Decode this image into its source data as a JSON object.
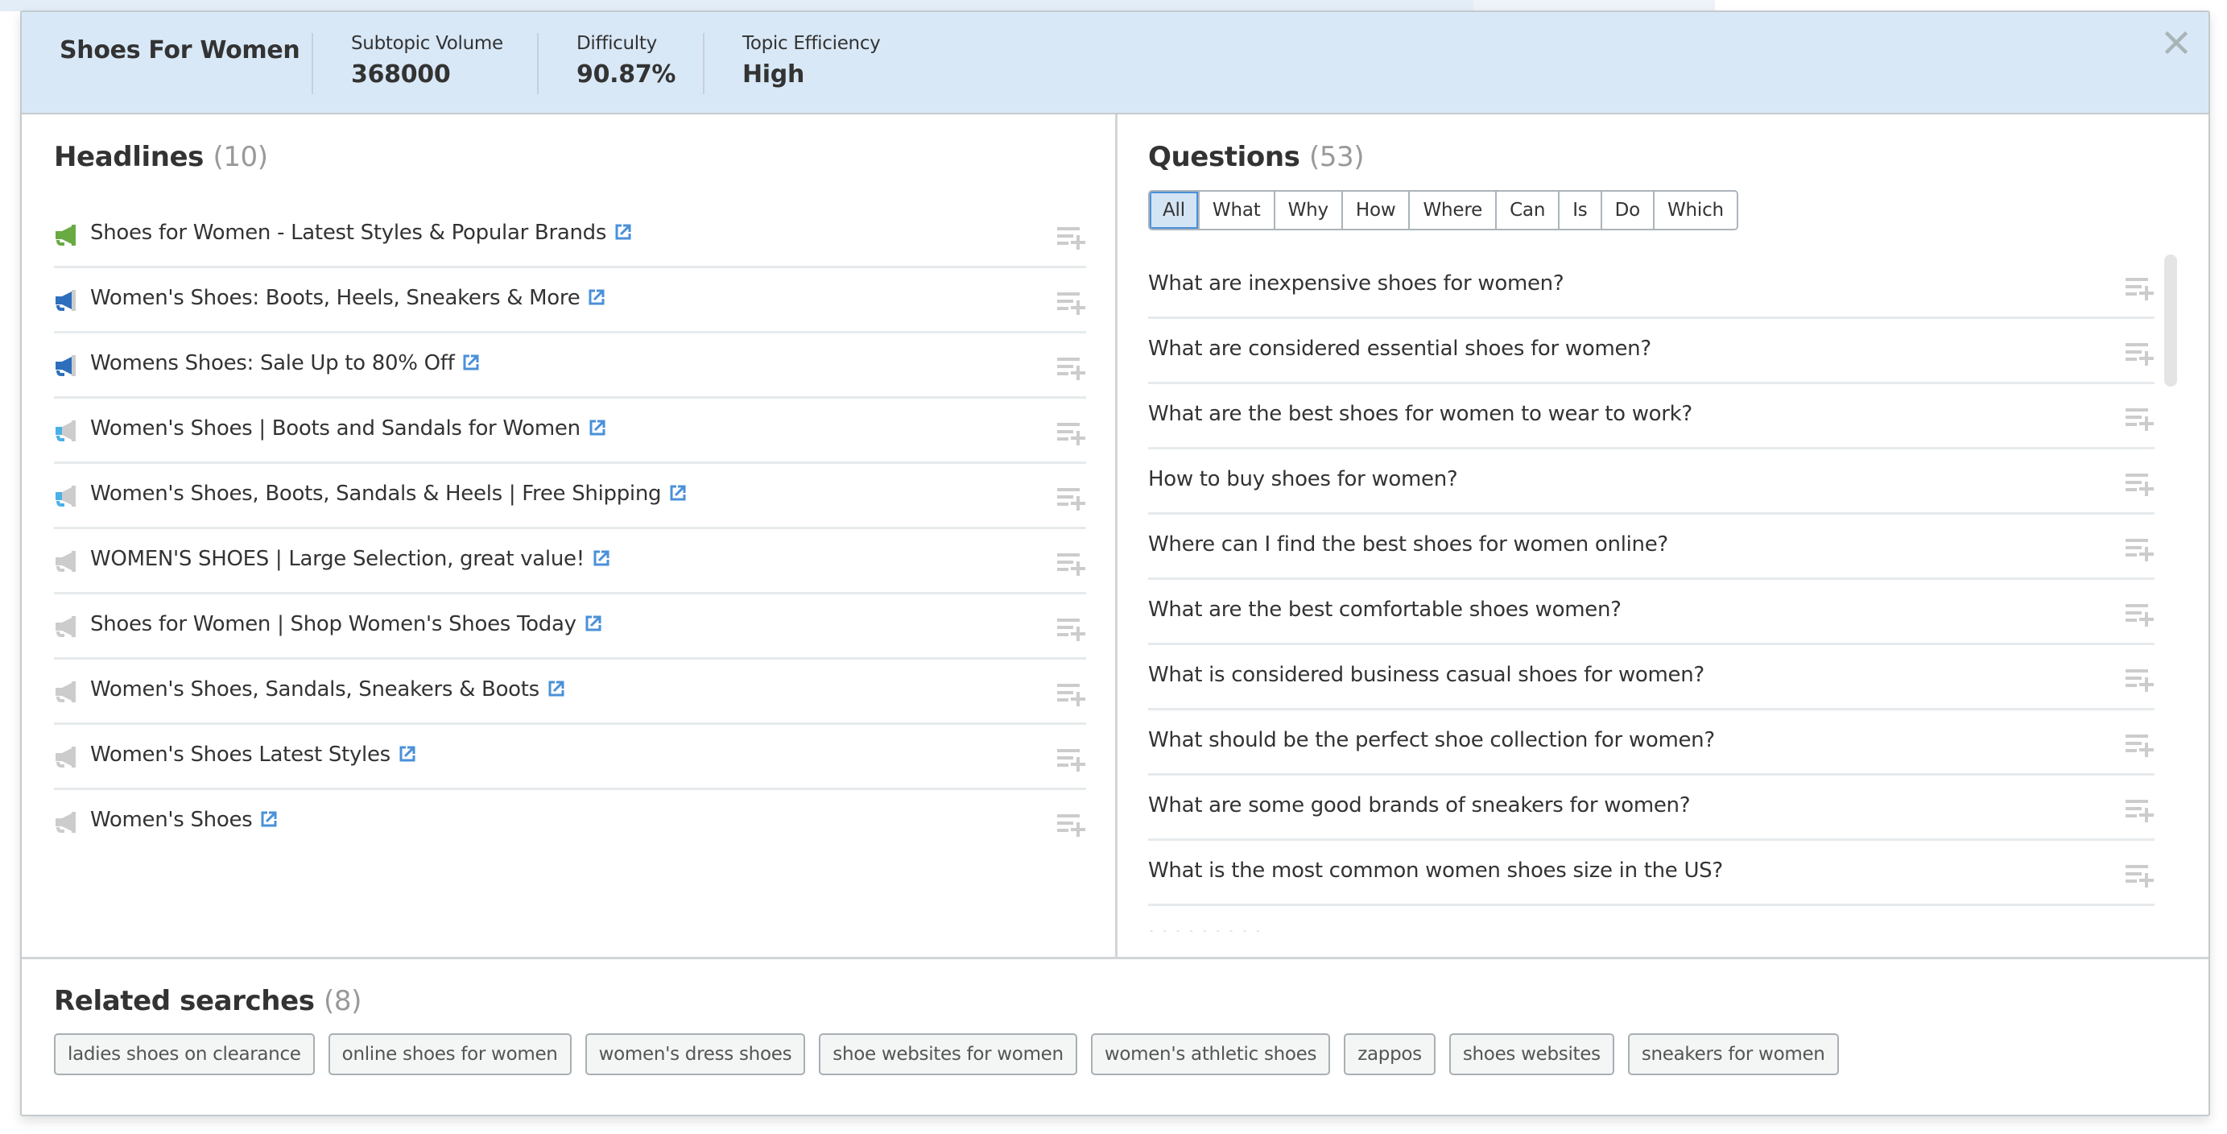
{
  "header": {
    "topic": "Shoes For Women",
    "stats": [
      {
        "label": "Subtopic Volume",
        "value": "368000"
      },
      {
        "label": "Difficulty",
        "value": "90.87%"
      },
      {
        "label": "Topic Efficiency",
        "value": "High"
      }
    ],
    "close_icon": "close-icon"
  },
  "headlines": {
    "title": "Headlines",
    "count": "(10)",
    "items": [
      {
        "text": "Shoes for Women - Latest Styles & Popular Brands",
        "strength": "full",
        "color": "#6aaa43"
      },
      {
        "text": "Women's Shoes: Boots, Heels, Sneakers & More",
        "strength": "high",
        "color": "#2d6fbd"
      },
      {
        "text": "Womens Shoes: Sale Up to 80% Off",
        "strength": "high",
        "color": "#2d6fbd"
      },
      {
        "text": "Women's Shoes | Boots and Sandals for Women",
        "strength": "medium",
        "color": "#4ab0e8"
      },
      {
        "text": "Women's Shoes, Boots, Sandals & Heels | Free Shipping",
        "strength": "medium",
        "color": "#4ab0e8"
      },
      {
        "text": "WOMEN'S SHOES | Large Selection, great value!",
        "strength": "low",
        "color": "#cccccc"
      },
      {
        "text": "Shoes for Women | Shop Women's Shoes Today",
        "strength": "low",
        "color": "#cccccc"
      },
      {
        "text": "Women's Shoes, Sandals, Sneakers & Boots",
        "strength": "low",
        "color": "#cccccc"
      },
      {
        "text": "Women's Shoes Latest Styles",
        "strength": "low",
        "color": "#cccccc"
      },
      {
        "text": "Women's Shoes",
        "strength": "low",
        "color": "#cccccc"
      }
    ]
  },
  "questions": {
    "title": "Questions",
    "count": "(53)",
    "filters": [
      "All",
      "What",
      "Why",
      "How",
      "Where",
      "Can",
      "Is",
      "Do",
      "Which"
    ],
    "active_filter": "All",
    "items": [
      "What are inexpensive shoes for women?",
      "What are considered essential shoes for women?",
      "What are the best shoes for women to wear to work?",
      "How to buy shoes for women?",
      "Where can I find the best shoes for women online?",
      "What are the best comfortable shoes women?",
      "What is considered business casual shoes for women?",
      "What should be the perfect shoe collection for women?",
      "What are some good brands of sneakers for women?",
      "What is the most common women shoes size in the US?"
    ]
  },
  "related": {
    "title": "Related searches",
    "count": "(8)",
    "items": [
      "ladies shoes on clearance",
      "online shoes for women",
      "women's dress shoes",
      "shoe websites for women",
      "women's athletic shoes",
      "zappos",
      "shoes websites",
      "sneakers for women"
    ]
  },
  "colors": {
    "header_bg": "#d9e8f7",
    "link_blue": "#4a90d9",
    "inactive_gray": "#cccccc"
  }
}
